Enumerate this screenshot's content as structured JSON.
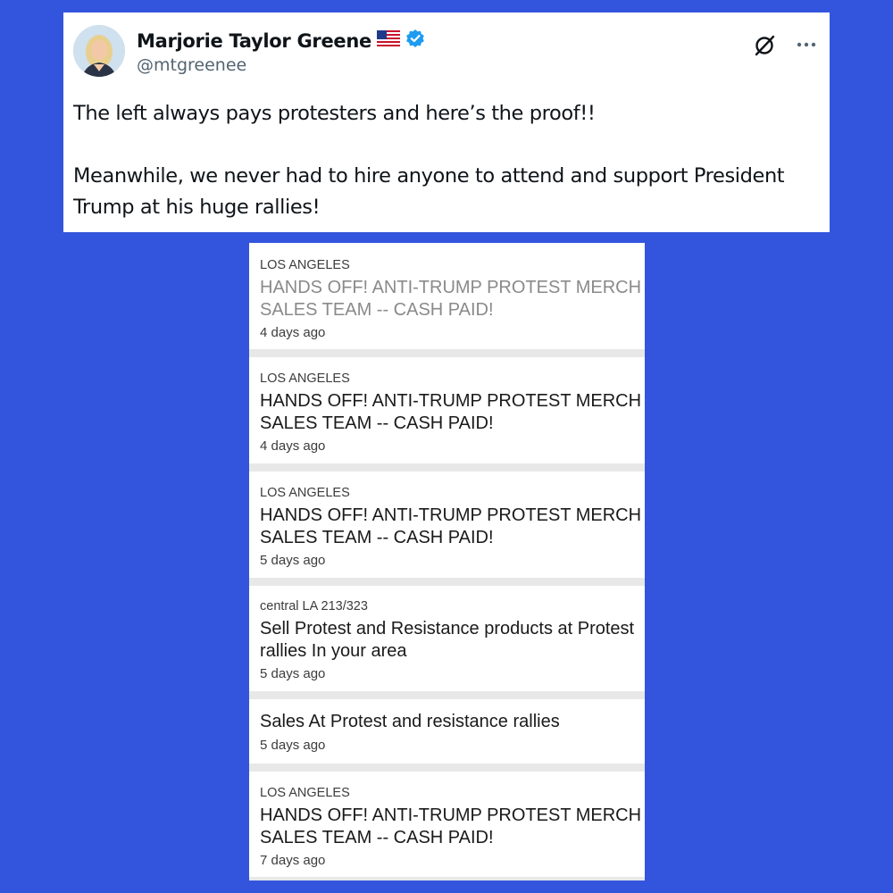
{
  "tweet": {
    "display_name": "Marjorie Taylor Greene",
    "flag_icon": "us-flag-icon",
    "verified_icon": "verified-badge-icon",
    "handle": "@mtgreenee",
    "paragraphs": [
      "The left always pays protesters and here’s the proof!!",
      "Meanwhile, we never had to hire anyone to attend and support President Trump at his huge rallies!"
    ]
  },
  "listings": [
    {
      "location": "LOS ANGELES",
      "title": "HANDS OFF! ANTI-TRUMP PROTEST MERCH SALES TEAM -- CASH PAID!",
      "age": "4 days ago"
    },
    {
      "location": "LOS ANGELES",
      "title": "HANDS OFF! ANTI-TRUMP PROTEST MERCH SALES TEAM -- CASH PAID!",
      "age": "4 days ago"
    },
    {
      "location": "LOS ANGELES",
      "title": "HANDS OFF! ANTI-TRUMP PROTEST MERCH SALES TEAM -- CASH PAID!",
      "age": "5 days ago"
    },
    {
      "location": "central LA 213/323",
      "title": "Sell Protest and Resistance products at Protest rallies In your area",
      "age": "5 days ago"
    },
    {
      "location": "",
      "title": "Sales At Protest and resistance rallies",
      "age": "5 days ago"
    },
    {
      "location": "LOS ANGELES",
      "title": "HANDS OFF! ANTI-TRUMP PROTEST MERCH SALES TEAM -- CASH PAID!",
      "age": "7 days ago"
    }
  ],
  "colors": {
    "background": "#3355dd",
    "verified": "#1d9bf0",
    "visited_title": "#8a8a8a"
  }
}
